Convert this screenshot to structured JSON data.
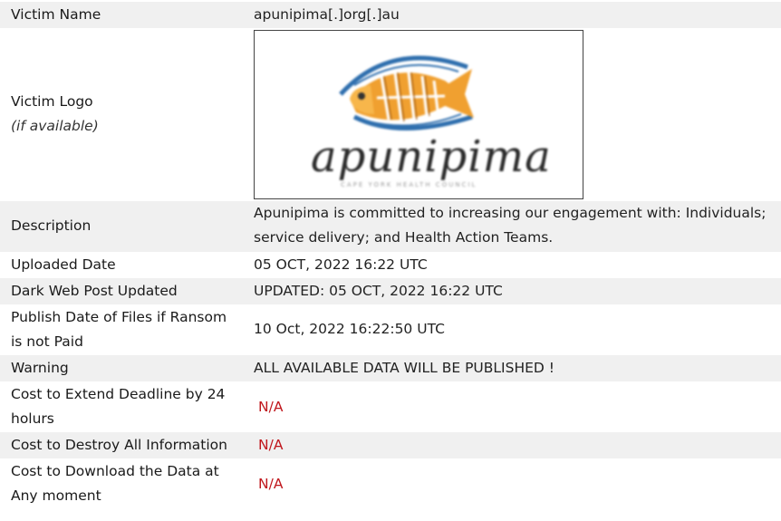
{
  "rows": {
    "victim_name": {
      "label": "Victim Name",
      "value": "apunipima[.]org[.]au"
    },
    "victim_logo": {
      "label": "Victim Logo",
      "sublabel": "(if available)",
      "logo_text": "apunipima",
      "logo_tagline": "CAPE YORK HEALTH COUNCIL"
    },
    "description": {
      "label": "Description",
      "line1": "Apunipima is committed to increasing our engagement with: Individuals;",
      "line2": "service delivery; and Health Action Teams."
    },
    "uploaded_date": {
      "label": "Uploaded Date",
      "value": "05 OCT, 2022 16:22 UTC"
    },
    "dark_web_post_updated": {
      "label": "Dark Web Post Updated",
      "value": "UPDATED: 05 OCT, 2022 16:22 UTC"
    },
    "publish_date": {
      "label_line1": "Publish Date of Files if Ransom",
      "label_line2": "is not Paid",
      "value": "10 Oct, 2022 16:22:50 UTC"
    },
    "warning": {
      "label": "Warning",
      "value": "ALL AVAILABLE DATA WILL BE PUBLISHED !"
    },
    "cost_extend": {
      "label_line1": "Cost to Extend Deadline by 24",
      "label_line2": "holurs",
      "value": "N/A"
    },
    "cost_destroy": {
      "label": "Cost to Destroy All Information",
      "value": "N/A"
    },
    "cost_download": {
      "label_line1": "Cost to Download the Data at",
      "label_line2": "Any moment",
      "value": "N/A"
    }
  },
  "colors": {
    "stripe": "#f0f0f0",
    "na_red": "#c0171d",
    "fish_orange": "#f0a030",
    "fish_blue": "#2f6fae"
  }
}
